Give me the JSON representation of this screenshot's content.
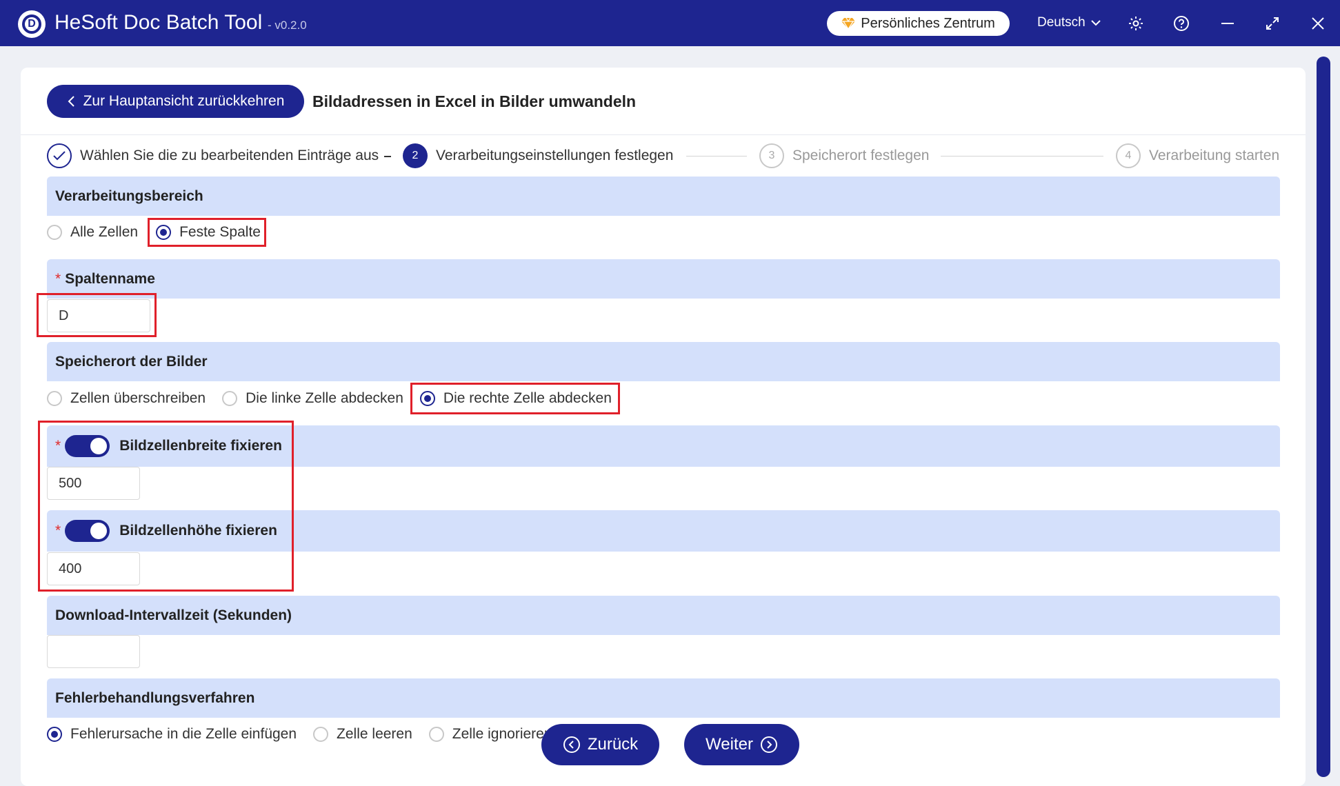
{
  "app": {
    "title": "HeSoft Doc Batch Tool",
    "version": "- v0.2.0",
    "personal_center": "Persönliches Zentrum",
    "language": "Deutsch"
  },
  "header": {
    "back_label": "Zur Hauptansicht zurückkehren",
    "page_title": "Bildadressen in Excel in Bilder umwandeln"
  },
  "steps": [
    {
      "num": "✓",
      "label": "Wählen Sie die zu bearbeitenden Einträge aus",
      "state": "done"
    },
    {
      "num": "2",
      "label": "Verarbeitungseinstellungen festlegen",
      "state": "active"
    },
    {
      "num": "3",
      "label": "Speicherort festlegen",
      "state": "pending"
    },
    {
      "num": "4",
      "label": "Verarbeitung starten",
      "state": "pending"
    }
  ],
  "sections": {
    "range": {
      "title": "Verarbeitungsbereich",
      "options": [
        "Alle Zellen",
        "Feste Spalte"
      ],
      "selected": "Feste Spalte"
    },
    "column": {
      "title": "Spaltenname",
      "value": "D"
    },
    "location": {
      "title": "Speicherort der Bilder",
      "options": [
        "Zellen überschreiben",
        "Die linke Zelle abdecken",
        "Die rechte Zelle abdecken"
      ],
      "selected": "Die rechte Zelle abdecken"
    },
    "width": {
      "title": "Bildzellenbreite fixieren",
      "enabled": true,
      "value": "500"
    },
    "height": {
      "title": "Bildzellenhöhe fixieren",
      "enabled": true,
      "value": "400"
    },
    "interval": {
      "title": "Download-Intervallzeit (Sekunden)",
      "value": ""
    },
    "error": {
      "title": "Fehlerbehandlungsverfahren",
      "options": [
        "Fehlerursache in die Zelle einfügen",
        "Zelle leeren",
        "Zelle ignorieren"
      ],
      "selected": "Fehlerursache in die Zelle einfügen"
    }
  },
  "footer": {
    "back": "Zurück",
    "next": "Weiter"
  },
  "colors": {
    "primary": "#1e2590",
    "section_bg": "#d4e0fb",
    "highlight": "#e0202a"
  }
}
